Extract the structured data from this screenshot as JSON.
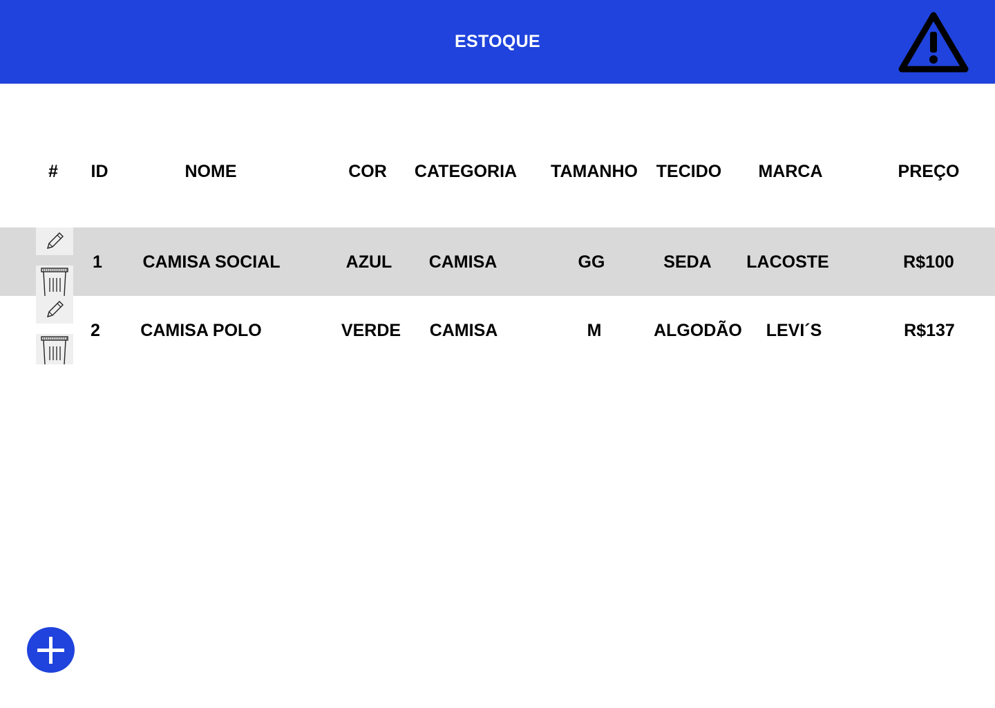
{
  "header": {
    "title": "ESTOQUE",
    "background_color": "#1f43dc",
    "alert_icon": "warning-triangle-icon"
  },
  "table": {
    "columns": [
      "#",
      "ID",
      "NOME",
      "COR",
      "CATEGORIA",
      "TAMANHO",
      "TECIDO",
      "MARCA",
      "PREÇO"
    ],
    "rows": [
      {
        "id": "1",
        "nome": "CAMISA SOCIAL",
        "cor": "AZUL",
        "categoria": "CAMISA",
        "tamanho": "GG",
        "tecido": "SEDA",
        "marca": "LACOSTE",
        "preco": "R$100"
      },
      {
        "id": "2",
        "nome": "CAMISA POLO",
        "cor": "VERDE",
        "categoria": "CAMISA",
        "tamanho": "M",
        "tecido": "ALGODÃO",
        "marca": "LEVI´S",
        "preco": "R$137"
      }
    ],
    "row_actions": [
      "pencil-icon",
      "trash-icon"
    ],
    "shaded_row_color": "#d9d9d9"
  },
  "fab": {
    "icon": "plus-icon",
    "color": "#1f43dc"
  }
}
